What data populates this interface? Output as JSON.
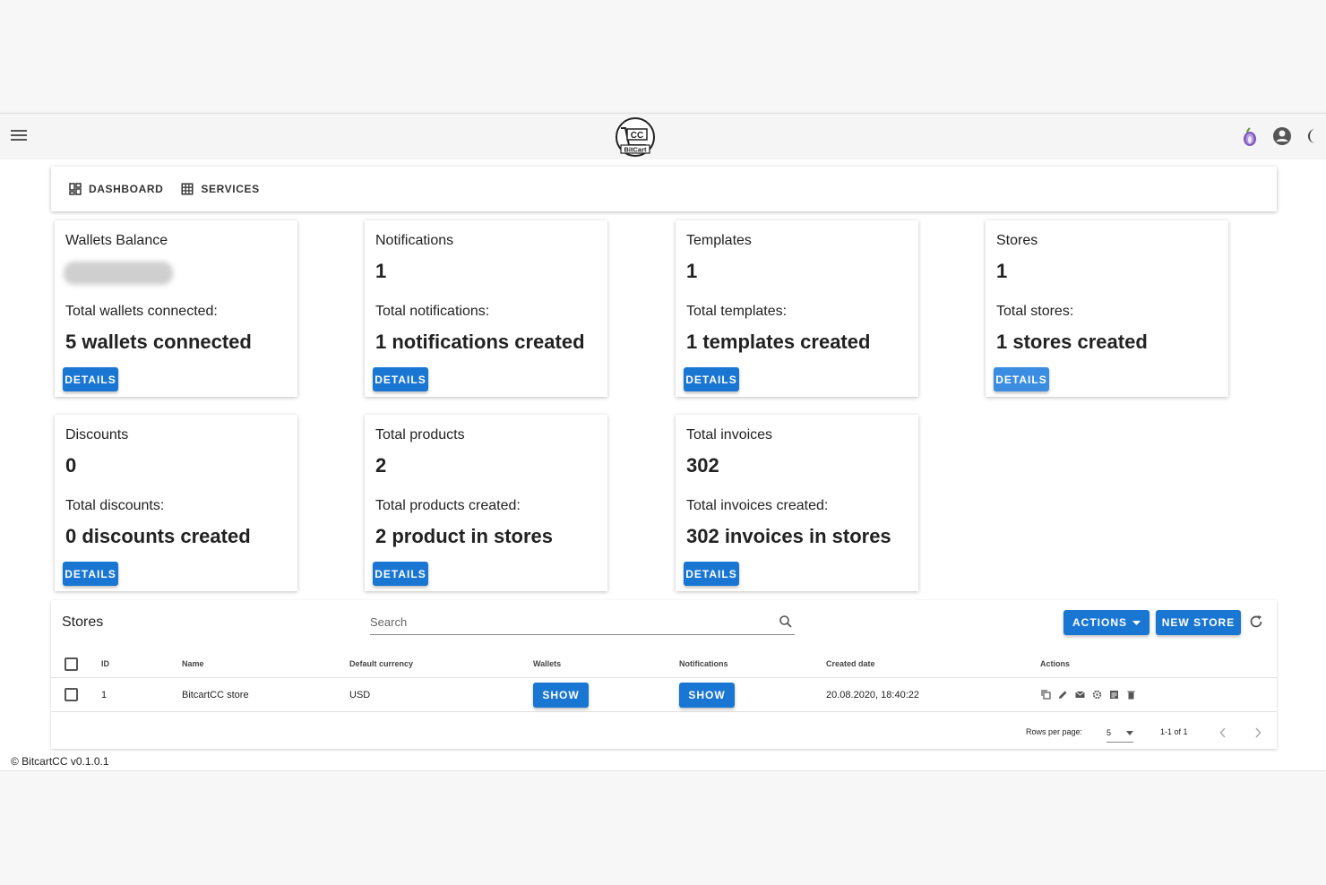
{
  "nav": {
    "dashboard_label": "DASHBOARD",
    "services_label": "SERVICES"
  },
  "cards": [
    {
      "title": "Wallets Balance",
      "value": "",
      "sub": "Total wallets connected:",
      "big": "5 wallets connected",
      "button": "DETAILS"
    },
    {
      "title": "Notifications",
      "value": "1",
      "sub": "Total notifications:",
      "big": "1 notifications created",
      "button": "DETAILS"
    },
    {
      "title": "Templates",
      "value": "1",
      "sub": "Total templates:",
      "big": "1 templates created",
      "button": "DETAILS"
    },
    {
      "title": "Stores",
      "value": "1",
      "sub": "Total stores:",
      "big": "1 stores created",
      "button": "DETAILS"
    },
    {
      "title": "Discounts",
      "value": "0",
      "sub": "Total discounts:",
      "big": "0 discounts created",
      "button": "DETAILS"
    },
    {
      "title": "Total products",
      "value": "2",
      "sub": "Total products created:",
      "big": "2 product in stores",
      "button": "DETAILS"
    },
    {
      "title": "Total invoices",
      "value": "302",
      "sub": "Total invoices created:",
      "big": "302 invoices in stores",
      "button": "DETAILS"
    }
  ],
  "stores_table": {
    "title": "Stores",
    "search_placeholder": "Search",
    "actions_label": "ACTIONS",
    "new_store_label": "NEW STORE",
    "columns": {
      "id": "ID",
      "name": "Name",
      "currency": "Default currency",
      "wallets": "Wallets",
      "notifications": "Notifications",
      "created": "Created date",
      "actions": "Actions"
    },
    "rows": [
      {
        "id": "1",
        "name": "BitcartCC store",
        "currency": "USD",
        "wallets_button": "SHOW",
        "notifications_button": "SHOW",
        "created": "20.08.2020, 18:40:22"
      }
    ],
    "rows_per_page_label": "Rows per page:",
    "rows_per_page_value": "5",
    "range_text": "1-1 of 1"
  },
  "footer": {
    "copyright": "© BitcartCC v0.1.0.1"
  },
  "colors": {
    "primary": "#1976d2",
    "primary_light": "#3a8de0"
  }
}
